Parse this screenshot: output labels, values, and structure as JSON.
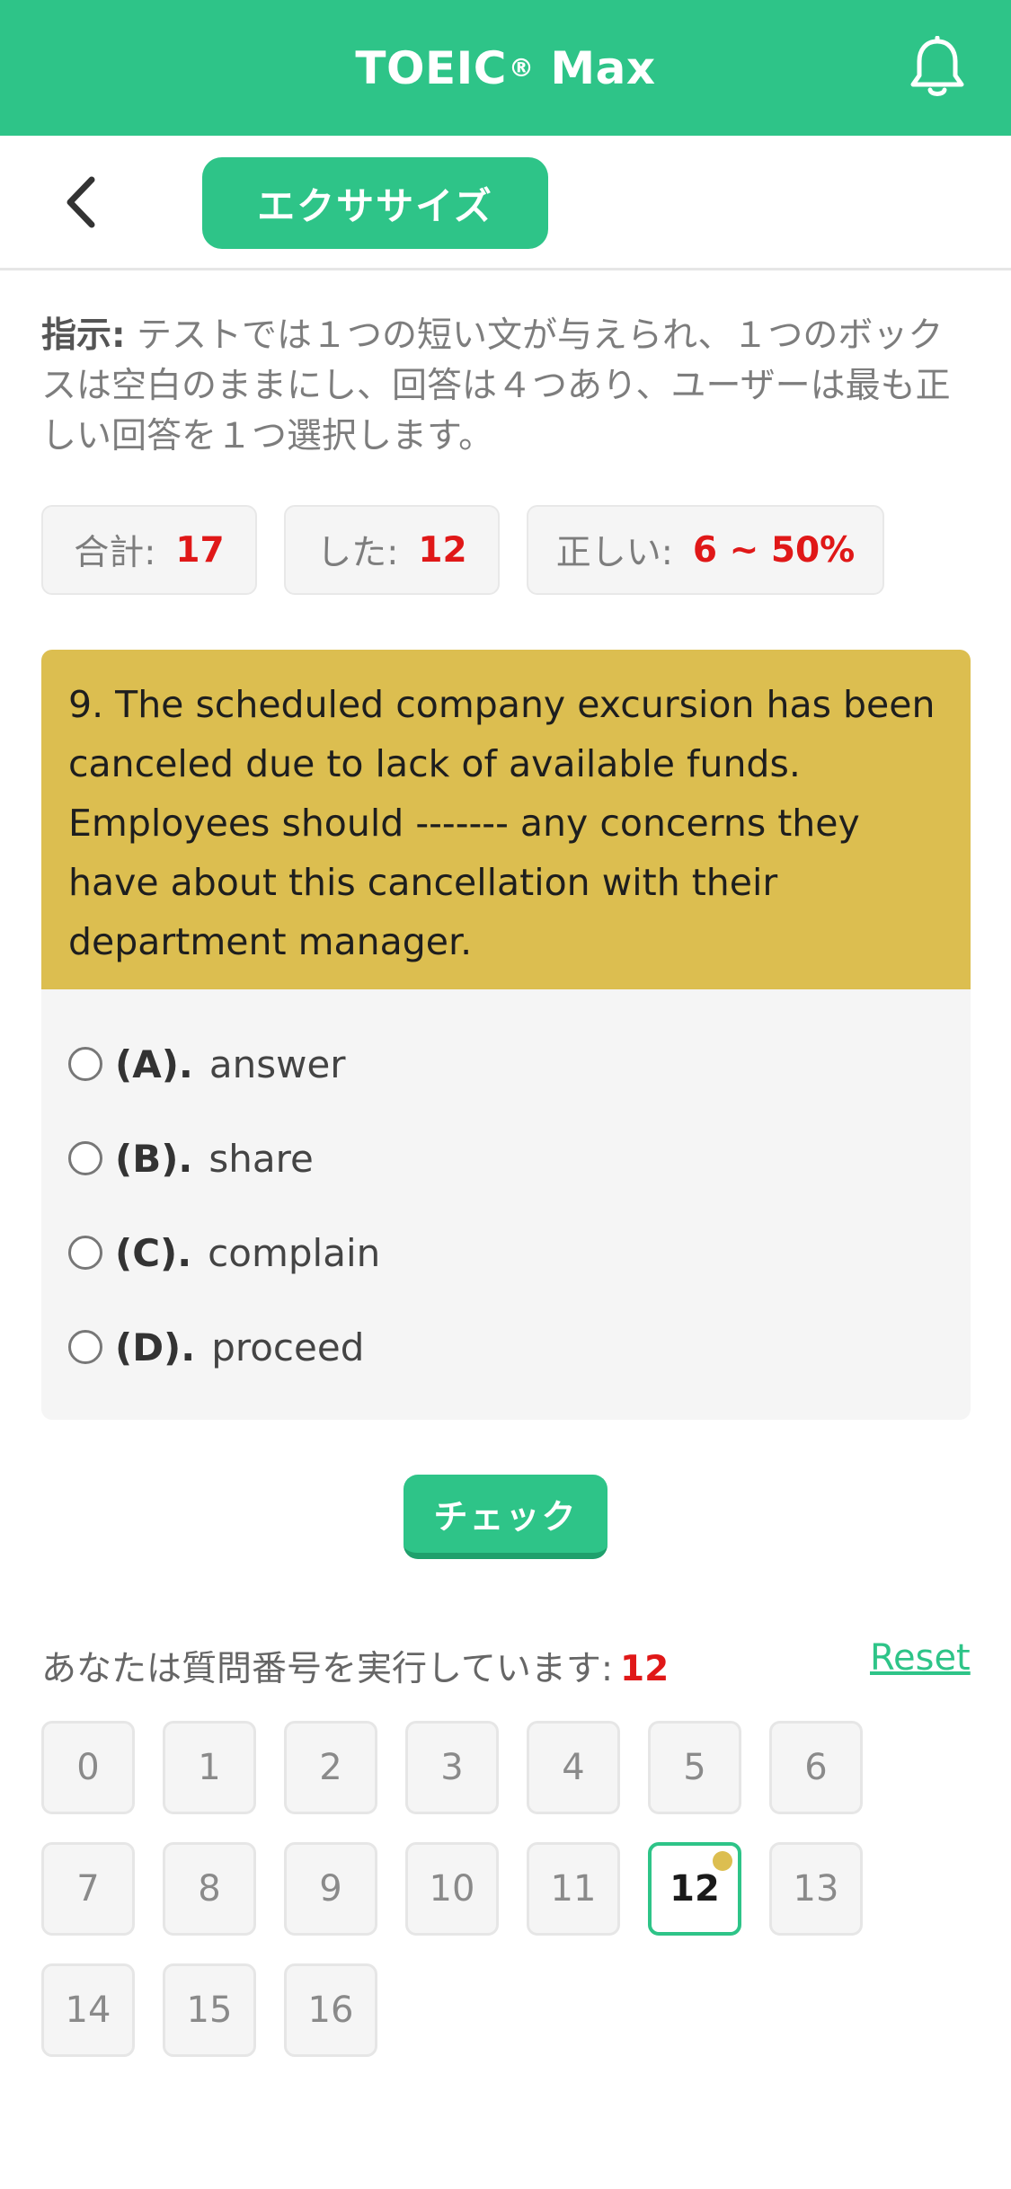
{
  "header": {
    "title": "TOEIC",
    "title_mark": "®",
    "title_suffix": " Max",
    "bell_icon": "bell-icon"
  },
  "subbar": {
    "back_icon": "chevron-left-icon",
    "tab_label": "エクササイズ"
  },
  "instructions": {
    "label": "指示:",
    "text": " テストでは１つの短い文が与えられ、１つのボックスは空白のままにし、回答は４つあり、ユーザーは最も正しい回答を１つ選択します。"
  },
  "stats": {
    "total_label": "合計:",
    "total_value": "17",
    "done_label": "した:",
    "done_value": "12",
    "correct_label": "正しい:",
    "correct_value": "6 ~ 50%"
  },
  "question": {
    "text": "9. The scheduled company excursion has been canceled due to lack of available funds. Employees should ------- any concerns they have about this cancellation with their department manager.",
    "options": [
      {
        "label": "(A).",
        "text": "answer"
      },
      {
        "label": "(B).",
        "text": "share"
      },
      {
        "label": "(C).",
        "text": "complain"
      },
      {
        "label": "(D).",
        "text": "proceed"
      }
    ]
  },
  "check_label": "チェック",
  "progress": {
    "label": "あなたは質問番号を実行しています:",
    "current": "12",
    "reset_label": "Reset"
  },
  "question_numbers": [
    "0",
    "1",
    "2",
    "3",
    "4",
    "5",
    "6",
    "7",
    "8",
    "9",
    "10",
    "11",
    "12",
    "13",
    "14",
    "15",
    "16"
  ],
  "colors": {
    "brand": "#2ec488",
    "question_bg": "#dcbe50",
    "accent_red": "#e01818"
  }
}
